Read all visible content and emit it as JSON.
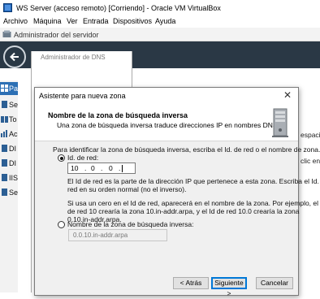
{
  "window": {
    "title": "WS Server (acceso remoto) [Corriendo] - Oracle VM VirtualBox",
    "menu": [
      "Archivo",
      "Máquina",
      "Ver",
      "Entrada",
      "Dispositivos",
      "Ayuda"
    ]
  },
  "server_manager": {
    "title": "Administrador del servidor",
    "sidebar": [
      "Pa",
      "Se",
      "To",
      "Ac",
      "DI",
      "DI",
      "IIS",
      "Se"
    ],
    "right_fragments": [
      "espacio",
      "clic en Ze"
    ]
  },
  "dns_manager": {
    "title": "Administrador de DNS"
  },
  "dialog": {
    "title": "Asistente para nueva zona",
    "close": "✕",
    "header_title": "Nombre de la zona de búsqueda inversa",
    "header_subtitle": "Una zona de búsqueda inversa traduce direcciones IP en nombres DNS.",
    "instruction": "Para identificar la zona de búsqueda inversa, escriba el Id. de red o el nombre de zona.",
    "radio_network_id": "Id. de red:",
    "network_id": [
      "10",
      "0",
      "0",
      ""
    ],
    "help_line1": "El Id de red es la parte de la dirección IP que pertenece a esta zona. Escriba el Id. de",
    "help_line2": "red en su orden normal (no el inverso).",
    "zero_line1": "Si usa un cero en el Id de red, aparecerá en el nombre de la zona.  Por ejemplo, el Id",
    "zero_line2": "de red 10 crearía la zona 10.in-addr.arpa, y el Id de red 10.0 crearía la zona",
    "zero_line3": "0.10.in-addr.arpa.",
    "radio_zone_name": "Nombre de la zona de búsqueda inversa:",
    "zone_name_value": "0.0.10.in-addr.arpa",
    "back_button": "< Atrás",
    "next_button": "Siguiente >",
    "cancel_button": "Cancelar"
  }
}
